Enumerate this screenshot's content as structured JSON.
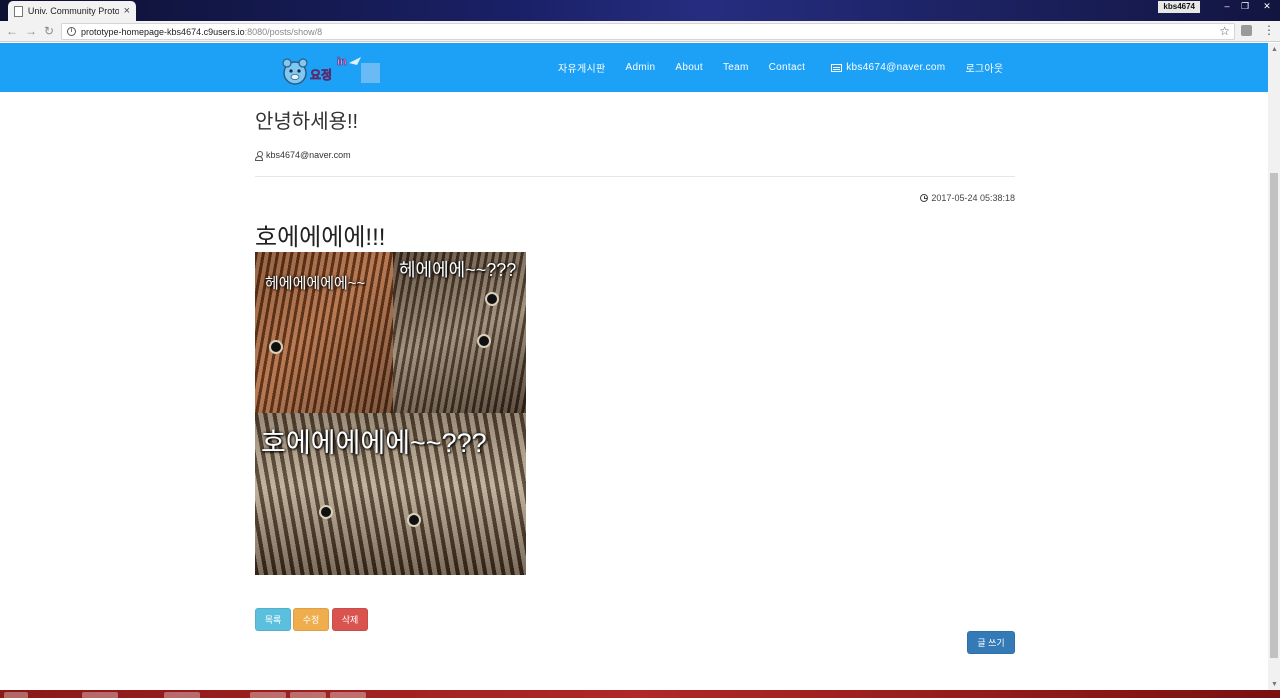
{
  "browser": {
    "tab_title": "Univ. Community Protot",
    "tab_close": "×",
    "user_badge": "kbs4674",
    "url_host": "prototype-homepage-kbs4674.c9users.io",
    "url_path": ":8080/posts/show/8",
    "icons": [
      "back-icon",
      "forward-icon",
      "reload-icon",
      "info-icon",
      "star-icon",
      "menu-icon"
    ]
  },
  "navbar": {
    "logo_text": "요정 in",
    "links": {
      "board": "자유게시판",
      "admin": "Admin",
      "about": "About",
      "team": "Team",
      "contact": "Contact",
      "email": "kbs4674@naver.com",
      "logout": "로그아웃"
    },
    "color": "#1da1f7"
  },
  "post": {
    "title": "안녕하세용!!",
    "author": "kbs4674@naver.com",
    "date": "2017-05-24 05:38:18",
    "body": "호에에에에!!!",
    "image": {
      "caption_top_left": "헤에에에에에~~",
      "caption_top_right": "헤에에에~~???",
      "caption_bottom": "호에에에에에~~???"
    }
  },
  "actions": {
    "list": "목록",
    "edit": "수정",
    "delete": "삭제",
    "write": "글 쓰기"
  },
  "colors": {
    "info": "#5bc0de",
    "warning": "#f0ad4e",
    "danger": "#d9534f",
    "primary": "#337ab7"
  }
}
